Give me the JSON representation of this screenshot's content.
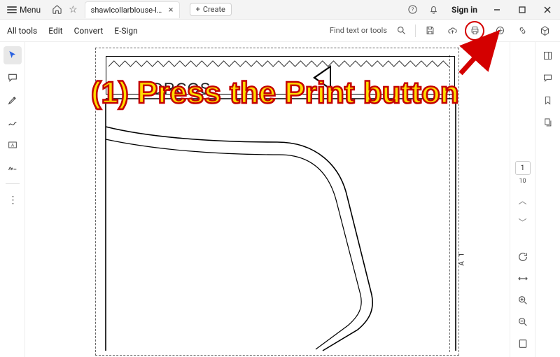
{
  "titlebar": {
    "menu_label": "Menu",
    "tab_title": "shawlcollarblouse-lm.p...",
    "create_label": "Create",
    "signin_label": "Sign in"
  },
  "toolbar": {
    "all_tools": "All tools",
    "edit": "Edit",
    "convert": "Convert",
    "esign": "E-Sign",
    "search_placeholder": "Find text or tools"
  },
  "document": {
    "brand": "DRCOS",
    "side_label": "A 1"
  },
  "pager": {
    "current": "1",
    "total": "10"
  },
  "annotation": {
    "text": "(1) Press the Print button"
  }
}
